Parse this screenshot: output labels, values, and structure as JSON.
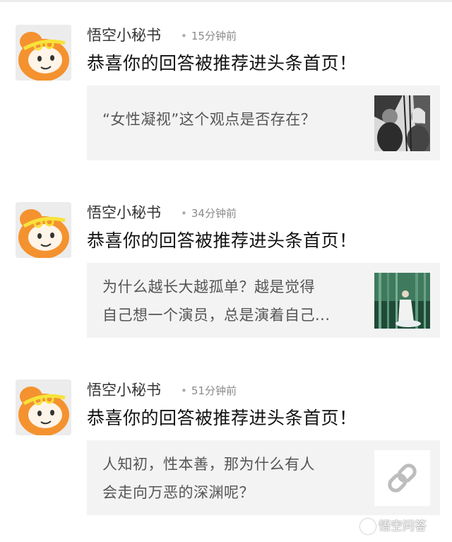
{
  "notifications": [
    {
      "sender": "悟空小秘书",
      "time": "15分钟前",
      "message": "恭喜你的回答被推荐进头条首页！",
      "card_line1": "“女性凝视”这个观点是否存在？",
      "card_line2": "",
      "thumb": "photo-two-women-thumbnail"
    },
    {
      "sender": "悟空小秘书",
      "time": "34分钟前",
      "message": "恭喜你的回答被推荐进头条首页！",
      "card_line1": "为什么越长大越孤单？越是觉得",
      "card_line2": "自己想一个演员，总是演着自己...",
      "thumb": "photo-forest-woman-thumbnail"
    },
    {
      "sender": "悟空小秘书",
      "time": "51分钟前",
      "message": "恭喜你的回答被推荐进头条首页！",
      "card_line1": "人知初，性本善，那为什么有人",
      "card_line2": "会走向万恶的深渊呢？",
      "thumb": "link-icon"
    }
  ],
  "watermark": "悟空问答",
  "colors": {
    "avatar_orange": "#f4922f",
    "card_bg": "#f3f3f3",
    "time_gray": "#8a8a8a"
  }
}
